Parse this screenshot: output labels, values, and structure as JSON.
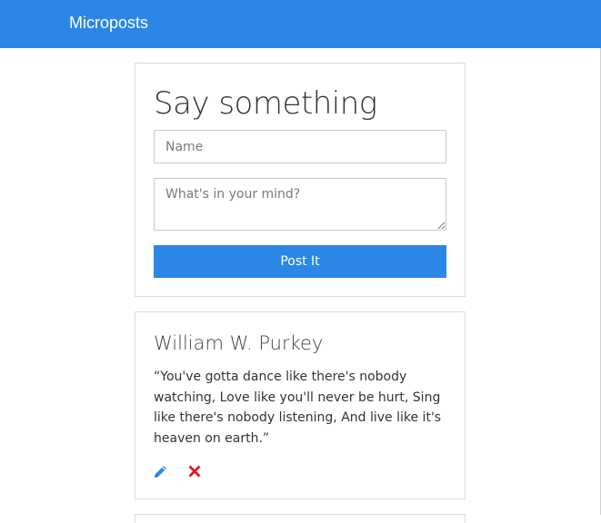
{
  "app": {
    "brand": "Microposts"
  },
  "form": {
    "title": "Say something",
    "name_placeholder": "Name",
    "body_placeholder": "What's in your mind?",
    "submit_label": "Post It"
  },
  "posts": [
    {
      "author": "William W. Purkey",
      "text": "“You've gotta dance like there's nobody watching, Love like you'll never be hurt, Sing like there's nobody listening, And live like it's heaven on earth.”",
      "edit_icon": "pencil-icon",
      "delete_icon": "close-icon"
    }
  ],
  "colors": {
    "navbar": "#2b86e6",
    "button": "#2b86e6",
    "edit_icon": "#2b86e6",
    "delete_icon": "#e0191f"
  }
}
